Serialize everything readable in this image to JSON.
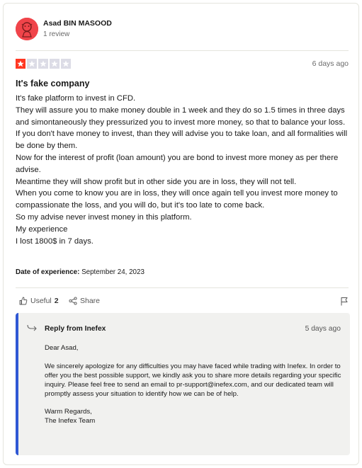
{
  "reviewer": {
    "name": "Asad BIN MASOOD",
    "review_count": "1 review"
  },
  "review": {
    "rating": 1,
    "max_rating": 5,
    "date": "6 days ago",
    "title": "It's fake company",
    "body": [
      "It's fake platform to invest in CFD.",
      "They will assure you to make money double in 1 week and they do so 1.5 times in three days and simontaneously they pressurized you to invest more money, so that to balance your loss.",
      "If you don't have money to invest, than they will advise you to take loan, and all formalities will be done by them.",
      "Now for the interest of profit (loan amount) you are bond to invest more money as per there advise.",
      "Meantime they will show profit but in other side you are in loss, they will not tell.",
      "When you come to know you are in loss, they will once again tell you invest more money to compassionate the loss, and you will do, but it's too late to come back.",
      "So my advise never invest money in this platform.",
      "My experience",
      "I lost 1800$ in 7 days."
    ],
    "experience_label": "Date of experience:",
    "experience_date": "September 24, 2023"
  },
  "actions": {
    "useful_label": "Useful",
    "useful_count": "2",
    "share_label": "Share"
  },
  "reply": {
    "title": "Reply from Inefex",
    "date": "5 days ago",
    "greeting": "Dear Asad,",
    "body": "We sincerely apologize for any difficulties you may have faced while trading with Inefex. In order to offer you the best possible support, we kindly ask you to share more details regarding your specific inquiry. Please feel free to send an email to pr-support@inefex.com, and our dedicated team will promptly assess your situation to identify how we can be of help.",
    "signoff_1": "Warm Regards,",
    "signoff_2": "The Inefex Team"
  },
  "colors": {
    "star_active": "#ff3722",
    "star_inactive": "#dcdce6",
    "reply_accent": "#2f58d4",
    "avatar_bg": "#f0444a"
  },
  "icons": [
    "user-avatar-icon",
    "star-icon",
    "thumbs-up-icon",
    "share-icon",
    "flag-icon",
    "reply-arrow-icon"
  ]
}
